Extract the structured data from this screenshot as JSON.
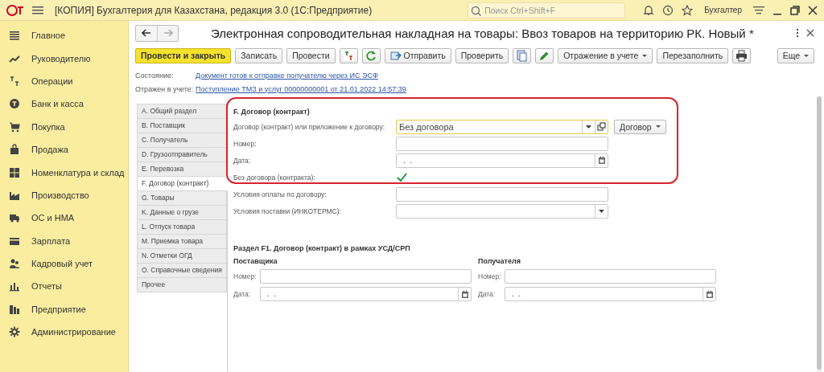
{
  "titlebar": {
    "title": "[КОПИЯ] Бухгалтерия для Казахстана, редакция 3.0  (1С:Предприятие)",
    "search_placeholder": "Поиск Ctrl+Shift+F",
    "user": "Бухгалтер"
  },
  "sidebar": {
    "items": [
      {
        "label": "Главное"
      },
      {
        "label": "Руководителю"
      },
      {
        "label": "Операции"
      },
      {
        "label": "Банк и касса"
      },
      {
        "label": "Покупка"
      },
      {
        "label": "Продажа"
      },
      {
        "label": "Номенклатура и склад"
      },
      {
        "label": "Производство"
      },
      {
        "label": "ОС и НМА"
      },
      {
        "label": "Зарплата"
      },
      {
        "label": "Кадровый учет"
      },
      {
        "label": "Отчеты"
      },
      {
        "label": "Предприятие"
      },
      {
        "label": "Администрирование"
      }
    ]
  },
  "document": {
    "title": "Электронная сопроводительная накладная на товары: Ввоз товаров на территорию РК. Новый *",
    "toolbar": [
      {
        "kind": "primary",
        "label": "Провести и закрыть"
      },
      {
        "kind": "button",
        "label": "Записать"
      },
      {
        "kind": "button",
        "label": "Провести"
      },
      {
        "kind": "icon"
      },
      {
        "kind": "icon"
      },
      {
        "kind": "icon-label",
        "label": "Отправить"
      },
      {
        "kind": "button",
        "label": "Проверить"
      },
      {
        "kind": "icon"
      },
      {
        "kind": "icon"
      },
      {
        "kind": "menu",
        "label": "Отражение в учете"
      },
      {
        "kind": "button",
        "label": "Перезаполнить"
      },
      {
        "kind": "icon"
      },
      {
        "kind": "menu-right",
        "label": "Еще"
      }
    ],
    "status": [
      {
        "label": "Состояние:",
        "link": "Документ готов к отправке получателю через ИС ЭСФ"
      },
      {
        "label": "Отражен в учете:",
        "link": "Поступление ТМЗ и услуг 00000000001 от 21.01.2022 14:57:39"
      }
    ]
  },
  "tabs": [
    {
      "label": "A. Общий раздел",
      "selected": false
    },
    {
      "label": "B. Поставщик",
      "selected": false
    },
    {
      "label": "C. Получатель",
      "selected": false
    },
    {
      "label": "D. Грузоотправитель",
      "selected": false
    },
    {
      "label": "E. Перевозка",
      "selected": false
    },
    {
      "label": "F. Договор (контракт)",
      "selected": true
    },
    {
      "label": "G. Товары",
      "selected": false
    },
    {
      "label": "K. Данные о грузе",
      "selected": false
    },
    {
      "label": "L. Отпуск товара",
      "selected": false
    },
    {
      "label": "M. Приемка товара",
      "selected": false
    },
    {
      "label": "N. Отметки ОГД",
      "selected": false
    },
    {
      "label": "O. Справочные сведения",
      "selected": false
    },
    {
      "label": "Прочее",
      "selected": false
    }
  ],
  "section": {
    "heading": "F. Договор (контракт)",
    "fields": [
      {
        "kind": "select-open",
        "label": "Договор (контракт) или приложение к договору:",
        "value": "Без договора",
        "button": "Договор"
      },
      {
        "kind": "text",
        "label": "Номер:"
      },
      {
        "kind": "date",
        "label": "Дата:",
        "value": ".  ."
      },
      {
        "kind": "checkbox",
        "label": "Без договора (контракта):",
        "checked": true
      },
      {
        "kind": "text",
        "label": "Условия оплаты по договору:"
      },
      {
        "kind": "select",
        "label": "Условия поставки (ИНКОТЕРМС):"
      }
    ]
  },
  "subsection": {
    "heading": "Раздел F1. Договор (контракт) в рамках УСД/СРП",
    "columns": [
      {
        "heading": "Поставщика",
        "fields": [
          {
            "kind": "text",
            "label": "Номер:"
          },
          {
            "kind": "date",
            "label": "Дата:",
            "value": ".  ."
          }
        ]
      },
      {
        "heading": "Получателя",
        "fields": [
          {
            "kind": "text",
            "label": "Номер:"
          },
          {
            "kind": "date",
            "label": "Дата:",
            "value": ".  ."
          }
        ]
      }
    ]
  }
}
